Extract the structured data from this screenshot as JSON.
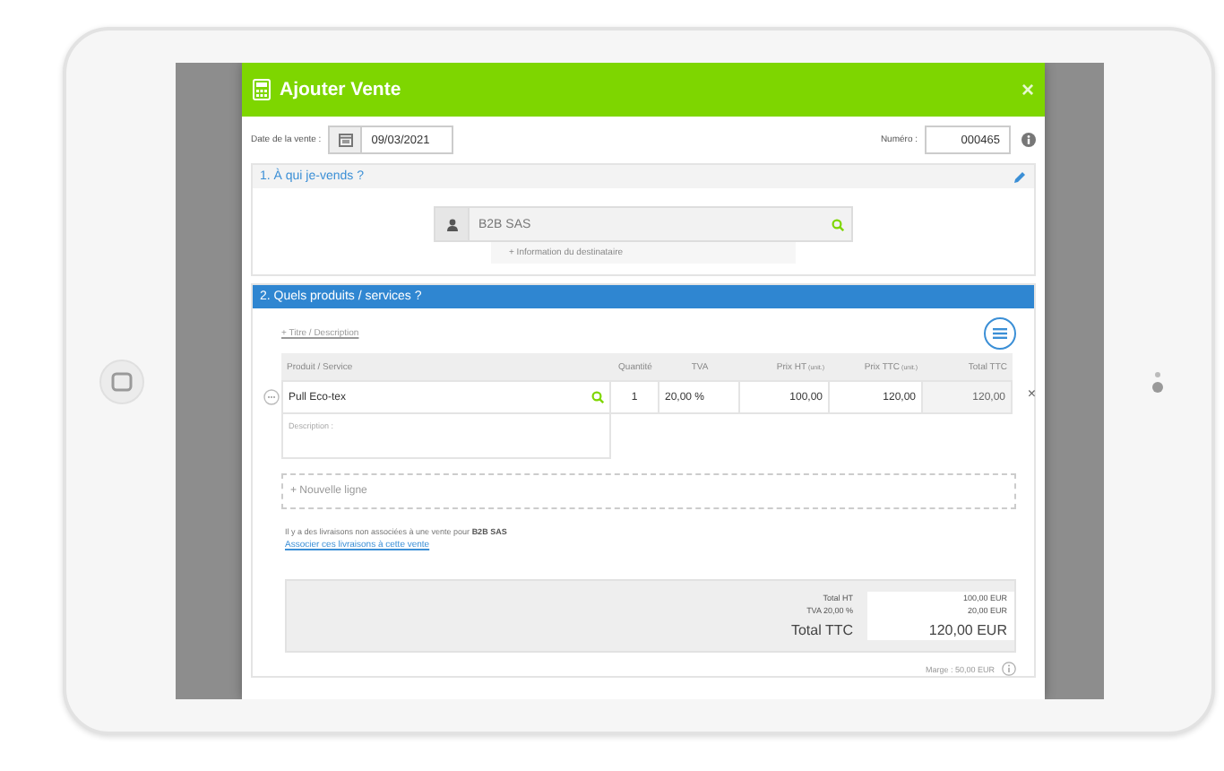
{
  "dialog": {
    "title": "Ajouter Vente",
    "close": "×"
  },
  "header_fields": {
    "date_label": "Date de la vente :",
    "date_value": "09/03/2021",
    "number_label": "Numéro :",
    "number_value": "000465"
  },
  "section_1": {
    "title": "1. À qui je-vends ?",
    "customer": "B2B SAS",
    "info_link": "+ Information du destinataire"
  },
  "section_2": {
    "title": "2. Quels produits / services ?",
    "title_link": "+ Titre / Description",
    "columns": [
      {
        "label": "Produit / Service"
      },
      {
        "label": "Quantité"
      },
      {
        "label": "TVA"
      },
      {
        "label": "Prix HT",
        "unit": "(unit.)"
      },
      {
        "label": "Prix TTC",
        "unit": "(unit.)"
      },
      {
        "label": "Total TTC"
      }
    ],
    "rows": [
      {
        "product": "Pull Eco-tex",
        "quantity": "1",
        "vat": "20,00 %",
        "price_ht": "100,00",
        "price_ttc": "120,00",
        "total_ttc": "120,00",
        "description_placeholder": "Description :",
        "remove": "×"
      }
    ],
    "new_line": "+ Nouvelle ligne",
    "notice": "Il y a des livraisons non associées à une vente pour **B2B SAS**",
    "notice_link": "Associer ces livraisons à cette vente",
    "totals": [
      {
        "label": "Total HT",
        "value": "100,00 EUR",
        "kind": "sub"
      },
      {
        "label": "TVA 20,00 %",
        "value": "20,00 EUR",
        "kind": "sub"
      },
      {
        "label": "Total TTC",
        "value": "120,00 EUR",
        "kind": "grand"
      }
    ],
    "margin": "Marge : 50,00 EUR"
  }
}
